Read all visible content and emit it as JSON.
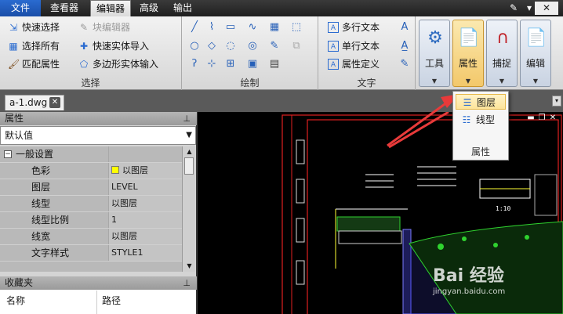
{
  "menu": {
    "file": "文件",
    "viewer": "查看器",
    "editor": "编辑器",
    "advanced": "高级",
    "output": "输出"
  },
  "ribbon": {
    "select": {
      "title": "选择",
      "quick_select": "快速选择",
      "select_all": "选择所有",
      "match_props": "匹配属性",
      "block_editor": "块编辑器",
      "quick_solid_import": "快速实体导入",
      "polygon_solid_import": "多边形实体输入"
    },
    "draw": {
      "title": "绘制"
    },
    "text": {
      "title": "文字",
      "mtext": "多行文本",
      "stext": "单行文本",
      "attdef": "属性定义"
    },
    "tools": "工具",
    "properties": "属性",
    "snap": "捕捉",
    "edit": "编辑"
  },
  "doc_tab": {
    "name": "a-1.dwg"
  },
  "properties_panel": {
    "title": "属性",
    "selection": "默认值",
    "rows": [
      {
        "key": "一般设置",
        "value": ""
      },
      {
        "key": "色彩",
        "value": "以图层"
      },
      {
        "key": "图层",
        "value": "LEVEL"
      },
      {
        "key": "线型",
        "value": "以图层"
      },
      {
        "key": "线型比例",
        "value": "1"
      },
      {
        "key": "线宽",
        "value": "以图层"
      },
      {
        "key": "文字样式",
        "value": "STYLE1"
      }
    ],
    "color_swatch": "#ffff00"
  },
  "favorites": {
    "title": "收藏夹",
    "col_name": "名称",
    "col_path": "路径"
  },
  "dropdown": {
    "layer": "图层",
    "linetype": "线型",
    "title": "属性"
  },
  "canvas": {
    "scale_note": "1:10"
  },
  "watermark": {
    "brand": "Bai 经验",
    "url": "jingyan.baidu.com"
  },
  "colors": {
    "accent": "#2a6bd0",
    "highlight": "#fde49a",
    "arrow": "#e83a3a"
  }
}
